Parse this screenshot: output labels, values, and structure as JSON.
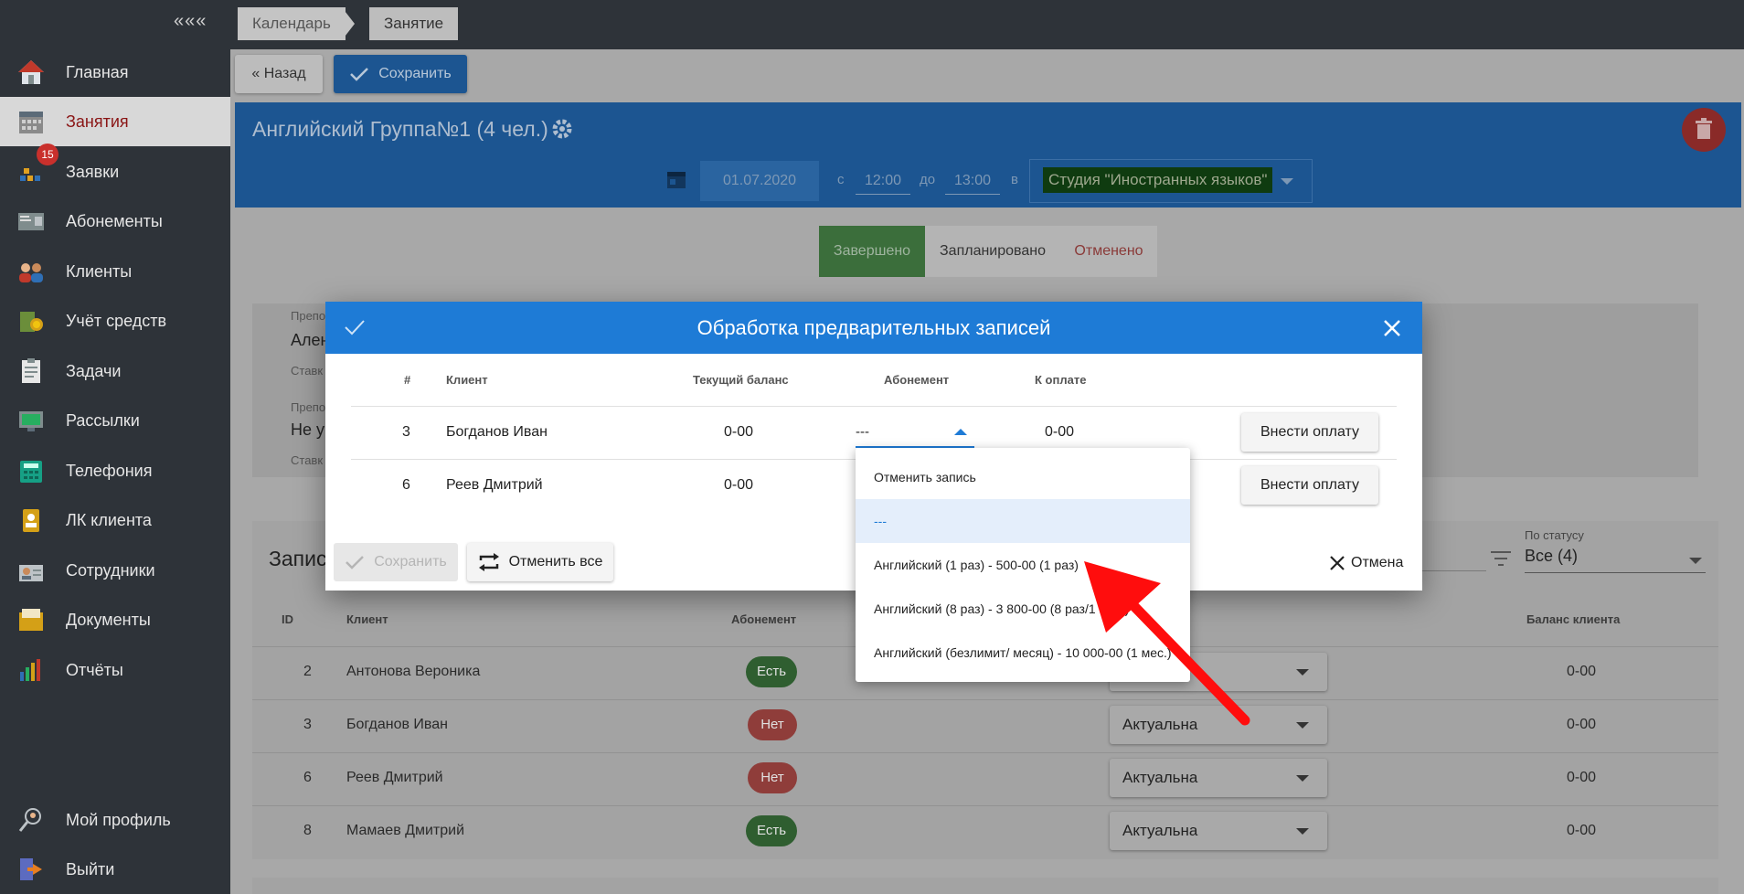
{
  "sidebar": {
    "collapse": "«««",
    "items": [
      {
        "label": "Главная",
        "icon": "home-icon"
      },
      {
        "label": "Занятия",
        "icon": "calendar-icon"
      },
      {
        "label": "Заявки",
        "icon": "requests-icon",
        "badge": "15"
      },
      {
        "label": "Абонементы",
        "icon": "subscription-card-icon"
      },
      {
        "label": "Клиенты",
        "icon": "clients-icon"
      },
      {
        "label": "Учёт средств",
        "icon": "money-icon"
      },
      {
        "label": "Задачи",
        "icon": "tasks-icon"
      },
      {
        "label": "Рассылки",
        "icon": "mailing-icon"
      },
      {
        "label": "Телефония",
        "icon": "phone-icon"
      },
      {
        "label": "ЛК клиента",
        "icon": "client-account-icon"
      },
      {
        "label": "Сотрудники",
        "icon": "staff-icon"
      },
      {
        "label": "Документы",
        "icon": "documents-icon"
      },
      {
        "label": "Отчёты",
        "icon": "reports-icon"
      }
    ],
    "bottom": [
      {
        "label": "Мой профиль",
        "icon": "profile-icon"
      },
      {
        "label": "Выйти",
        "icon": "logout-icon"
      }
    ]
  },
  "breadcrumbs": [
    "Календарь",
    "Занятие"
  ],
  "toolbar": {
    "back": "« Назад",
    "save": "Сохранить"
  },
  "lesson": {
    "title": "Английский Группа№1 (4 чел.)",
    "date": "01.07.2020",
    "from_label": "с",
    "from": "12:00",
    "to_label": "до",
    "to": "13:00",
    "in_label": "в",
    "room": "Студия \"Иностранных языков\""
  },
  "status_tabs": [
    "Завершено",
    "Запланировано",
    "Отменено"
  ],
  "card_fragments": {
    "teacher_label_1": "Препо",
    "teacher_value_1": "Ален",
    "rate_1": "Ставк",
    "teacher_label_2": "Препо",
    "teacher_value_2": "Не у",
    "rate_2": "Ставк"
  },
  "records": {
    "title_fragment": "Запис",
    "filter_label": "По статусу",
    "filter_value": "Все (4)",
    "columns": {
      "id": "ID",
      "client": "Клиент",
      "subscription": "Абонемент",
      "balance": "Баланс клиента"
    },
    "rows": [
      {
        "id": "2",
        "client": "Антонова Вероника",
        "sub": "Есть",
        "status": "",
        "balance": "0-00"
      },
      {
        "id": "3",
        "client": "Богданов Иван",
        "sub": "Нет",
        "status": "Актуальна",
        "balance": "0-00"
      },
      {
        "id": "6",
        "client": "Реев Дмитрий",
        "sub": "Нет",
        "status": "Актуальна",
        "balance": "0-00"
      },
      {
        "id": "8",
        "client": "Мамаев Дмитрий",
        "sub": "Есть",
        "status": "Актуальна",
        "balance": "0-00"
      }
    ],
    "colors": {
      "yes": "#3a7a3e",
      "no": "#a84542"
    }
  },
  "modal": {
    "title": "Обработка предварительных записей",
    "columns": {
      "num": "#",
      "client": "Клиент",
      "balance": "Текущий баланс",
      "subscription": "Абонемент",
      "to_pay": "К оплате"
    },
    "rows": [
      {
        "num": "3",
        "client": "Богданов Иван",
        "balance": "0-00",
        "subscription": "---",
        "to_pay": "0-00",
        "action": "Внести оплату"
      },
      {
        "num": "6",
        "client": "Реев Дмитрий",
        "balance": "0-00",
        "action": "Внести оплату"
      }
    ],
    "save": "Сохранить",
    "cancel_all": "Отменить все",
    "cancel": "Отмена",
    "dropdown_options": [
      "Отменить запись",
      "---",
      "Английский (1 раз) - 500-00 (1 раз)",
      "Английский (8 раз) - 3 800-00 (8 раз/1 мес.)",
      "Английский (безлимит/ месяц) - 10 000-00 (1 мес.)"
    ],
    "selected_option": "---"
  },
  "colors": {
    "accent": "#1e7bd6",
    "danger": "#e53935",
    "success": "#5cb85c",
    "room_bg": "#1d6b1d"
  }
}
